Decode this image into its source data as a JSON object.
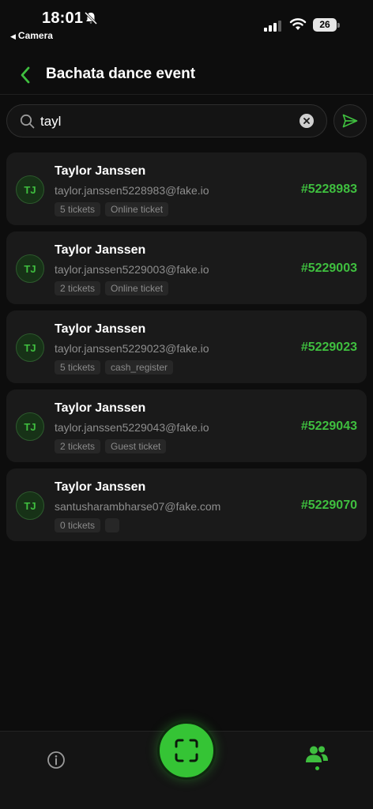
{
  "status_bar": {
    "time": "18:01",
    "back_app": "Camera",
    "battery": "26"
  },
  "header": {
    "title": "Bachata dance event"
  },
  "search": {
    "value": "tayl"
  },
  "attendees": [
    {
      "initials": "TJ",
      "name": "Taylor Janssen",
      "email": "taylor.janssen5228983@fake.io",
      "tickets": "5 tickets",
      "type": "Online ticket",
      "id": "#5228983"
    },
    {
      "initials": "TJ",
      "name": "Taylor Janssen",
      "email": "taylor.janssen5229003@fake.io",
      "tickets": "2 tickets",
      "type": "Online ticket",
      "id": "#5229003"
    },
    {
      "initials": "TJ",
      "name": "Taylor Janssen",
      "email": "taylor.janssen5229023@fake.io",
      "tickets": "5 tickets",
      "type": "cash_register",
      "id": "#5229023"
    },
    {
      "initials": "TJ",
      "name": "Taylor Janssen",
      "email": "taylor.janssen5229043@fake.io",
      "tickets": "2 tickets",
      "type": "Guest ticket",
      "id": "#5229043"
    },
    {
      "initials": "TJ",
      "name": "Taylor Janssen",
      "email": "santusharambharse07@fake.com",
      "tickets": "0 tickets",
      "type": "",
      "id": "#5229070"
    }
  ],
  "icons": {
    "status": [
      "mute-icon",
      "signal-icon",
      "wifi-icon"
    ],
    "header": "chevron-left-icon",
    "search": [
      "search-icon",
      "clear-icon",
      "send-icon"
    ],
    "nav": [
      "info-icon",
      "scan-icon",
      "people-icon"
    ]
  },
  "colors": {
    "accent": "#3fbf3f",
    "background": "#0d0d0d",
    "card": "#1a1a1a"
  }
}
